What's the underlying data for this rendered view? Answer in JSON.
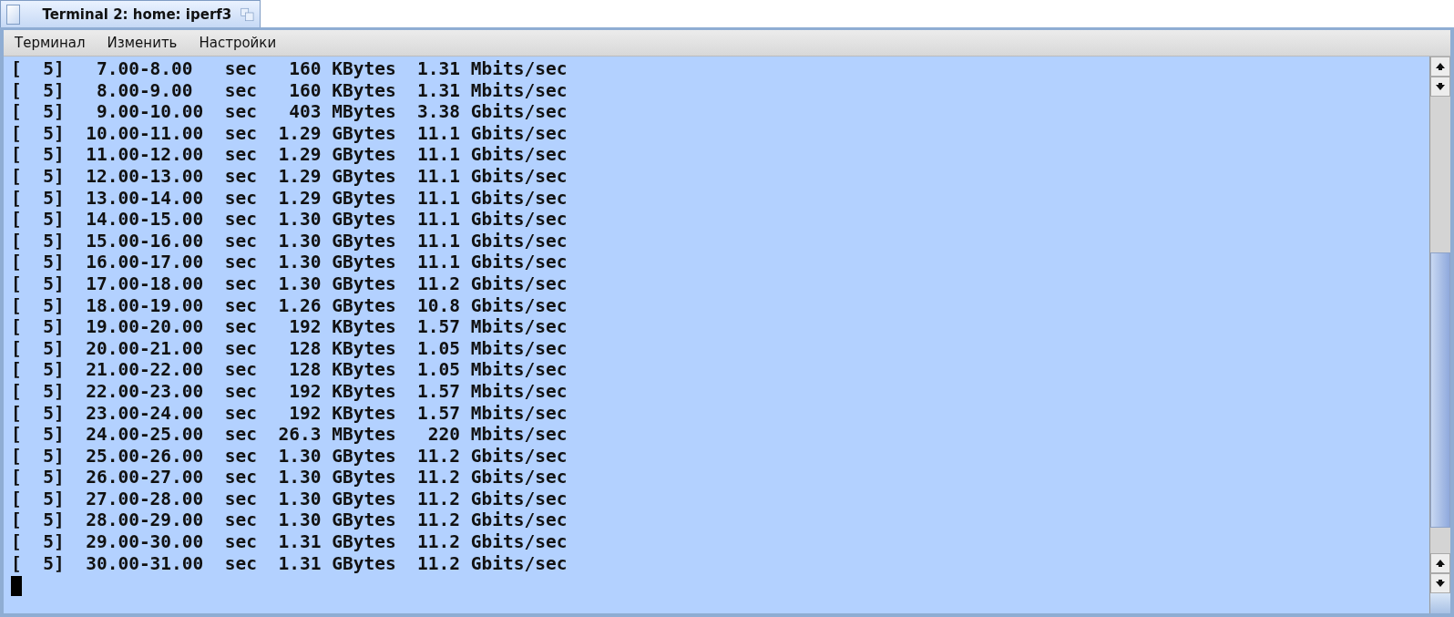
{
  "window": {
    "title": "Terminal 2: home: iperf3"
  },
  "menu": [
    "Терминал",
    "Изменить",
    "Настройки"
  ],
  "terminal": {
    "lines": [
      "[  5]   7.00-8.00   sec   160 KBytes  1.31 Mbits/sec",
      "[  5]   8.00-9.00   sec   160 KBytes  1.31 Mbits/sec",
      "[  5]   9.00-10.00  sec   403 MBytes  3.38 Gbits/sec",
      "[  5]  10.00-11.00  sec  1.29 GBytes  11.1 Gbits/sec",
      "[  5]  11.00-12.00  sec  1.29 GBytes  11.1 Gbits/sec",
      "[  5]  12.00-13.00  sec  1.29 GBytes  11.1 Gbits/sec",
      "[  5]  13.00-14.00  sec  1.29 GBytes  11.1 Gbits/sec",
      "[  5]  14.00-15.00  sec  1.30 GBytes  11.1 Gbits/sec",
      "[  5]  15.00-16.00  sec  1.30 GBytes  11.1 Gbits/sec",
      "[  5]  16.00-17.00  sec  1.30 GBytes  11.1 Gbits/sec",
      "[  5]  17.00-18.00  sec  1.30 GBytes  11.2 Gbits/sec",
      "[  5]  18.00-19.00  sec  1.26 GBytes  10.8 Gbits/sec",
      "[  5]  19.00-20.00  sec   192 KBytes  1.57 Mbits/sec",
      "[  5]  20.00-21.00  sec   128 KBytes  1.05 Mbits/sec",
      "[  5]  21.00-22.00  sec   128 KBytes  1.05 Mbits/sec",
      "[  5]  22.00-23.00  sec   192 KBytes  1.57 Mbits/sec",
      "[  5]  23.00-24.00  sec   192 KBytes  1.57 Mbits/sec",
      "[  5]  24.00-25.00  sec  26.3 MBytes   220 Mbits/sec",
      "[  5]  25.00-26.00  sec  1.30 GBytes  11.2 Gbits/sec",
      "[  5]  26.00-27.00  sec  1.30 GBytes  11.2 Gbits/sec",
      "[  5]  27.00-28.00  sec  1.30 GBytes  11.2 Gbits/sec",
      "[  5]  28.00-29.00  sec  1.30 GBytes  11.2 Gbits/sec",
      "[  5]  29.00-30.00  sec  1.31 GBytes  11.2 Gbits/sec",
      "[  5]  30.00-31.00  sec  1.31 GBytes  11.2 Gbits/sec"
    ]
  }
}
